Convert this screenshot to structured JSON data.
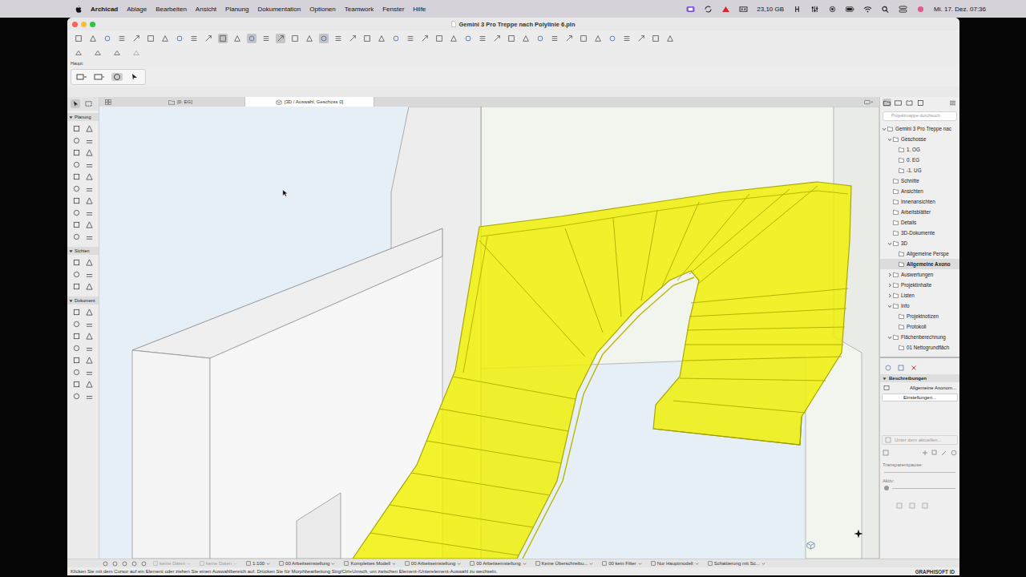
{
  "menubar": {
    "app": "Archicad",
    "items": [
      "Ablage",
      "Bearbeiten",
      "Ansicht",
      "Planung",
      "Dokumentation",
      "Optionen",
      "Teamwork",
      "Fenster",
      "Hilfe"
    ],
    "storage": "23,10 GB",
    "clock": "Mi. 17. Dez. 07:36"
  },
  "window": {
    "title": "Gemini 3 Pro Treppe nach Polylinie 6.pln"
  },
  "toolbar": [
    {
      "pressed": false
    },
    {
      "pressed": false
    },
    {
      "pressed": false
    },
    {
      "pressed": false
    },
    {
      "pressed": false
    },
    {
      "pressed": false
    },
    {
      "pressed": false
    },
    {
      "pressed": false
    },
    {
      "pressed": false
    },
    {
      "pressed": false
    },
    {
      "pressed": true
    },
    {
      "pressed": false
    },
    {
      "pressed": true
    },
    {
      "pressed": false
    },
    {
      "pressed": true
    },
    {
      "pressed": false
    },
    {
      "pressed": false
    },
    {
      "pressed": true
    },
    {
      "pressed": false
    },
    {
      "pressed": false
    },
    {
      "pressed": false
    },
    {
      "pressed": false
    },
    {
      "pressed": false
    },
    {
      "pressed": false
    },
    {
      "pressed": false
    },
    {
      "pressed": false
    },
    {
      "pressed": false
    },
    {
      "pressed": false
    },
    {
      "pressed": false
    },
    {
      "pressed": false
    },
    {
      "pressed": false
    },
    {
      "pressed": false
    },
    {
      "pressed": false
    },
    {
      "pressed": false
    },
    {
      "pressed": false
    },
    {
      "pressed": false
    },
    {
      "pressed": false
    },
    {
      "pressed": false
    },
    {
      "pressed": false
    },
    {
      "pressed": false
    },
    {
      "pressed": false
    },
    {
      "pressed": false
    }
  ],
  "infobox": {
    "label": "Haupt:"
  },
  "toolbox": {
    "pointer_selected": true,
    "sections": [
      {
        "label": "Planung",
        "expanded": true
      },
      {
        "label": "Sichten",
        "expanded": true
      },
      {
        "label": "Dokument",
        "expanded": true
      }
    ]
  },
  "tabs": [
    {
      "label": "[0. EG]",
      "selected": false
    },
    {
      "label": "[3D / Auswahl, Geschoss 0]",
      "selected": true
    }
  ],
  "navigator": {
    "search_placeholder": "Projektmappe durchsuch",
    "tree": [
      {
        "label": "Gemini 3 Pro Treppe nac",
        "kind": "open",
        "selected": false,
        "children": [
          {
            "label": "Geschosse",
            "kind": "open",
            "selected": false,
            "children": [
              {
                "label": "1. OG",
                "kind": "leaf",
                "selected": false
              },
              {
                "label": "0. EG",
                "kind": "leaf",
                "selected": false
              },
              {
                "label": "-1. UG",
                "kind": "leaf",
                "selected": false
              }
            ]
          },
          {
            "label": "Schnitte",
            "kind": "leaf",
            "selected": false
          },
          {
            "label": "Ansichten",
            "kind": "leaf",
            "selected": false
          },
          {
            "label": "Innenansichten",
            "kind": "leaf",
            "selected": false
          },
          {
            "label": "Arbeitsblätter",
            "kind": "leaf",
            "selected": false
          },
          {
            "label": "Details",
            "kind": "leaf",
            "selected": false
          },
          {
            "label": "3D-Dokumente",
            "kind": "leaf",
            "selected": false
          },
          {
            "label": "3D",
            "kind": "open",
            "selected": false,
            "children": [
              {
                "label": "Allgemeine Perspe",
                "kind": "leaf",
                "selected": false
              },
              {
                "label": "Allgemeine Axono",
                "kind": "leaf",
                "selected": true
              }
            ]
          },
          {
            "label": "Auswertungen",
            "kind": "closed",
            "selected": false
          },
          {
            "label": "Projektinhalte",
            "kind": "closed",
            "selected": false
          },
          {
            "label": "Listen",
            "kind": "closed",
            "selected": false
          },
          {
            "label": "Info",
            "kind": "open",
            "selected": false,
            "children": [
              {
                "label": "Projektnotizen",
                "kind": "leaf",
                "selected": false
              },
              {
                "label": "Protokoll",
                "kind": "leaf",
                "selected": false
              }
            ]
          },
          {
            "label": "Flächenberechnung",
            "kind": "open",
            "selected": false,
            "children": [
              {
                "label": "01 Nettogrundfläch",
                "kind": "leaf",
                "selected": false
              }
            ]
          }
        ]
      }
    ]
  },
  "properties": {
    "header": "Beschreibungen",
    "view_name": "Allgemeine Axonom...",
    "settings_button": "Einstellungen...",
    "layer_dropdown": "Unter dem aktuellen...",
    "transparency_label": "Transparentpause:",
    "active_label": "Aktiv:"
  },
  "status_bar": [
    {
      "label": "keine Daten",
      "disabled": true
    },
    {
      "label": "keine Daten",
      "disabled": true
    },
    {
      "label": "1:100",
      "disabled": false
    },
    {
      "label": "00 Arbeitseinstellung",
      "disabled": false
    },
    {
      "label": "Komplettes Modell",
      "disabled": false
    },
    {
      "label": "00 Arbeitseinstellung",
      "disabled": false
    },
    {
      "label": "00 Arbeitseinstellung",
      "disabled": false
    },
    {
      "label": "Keine Überschreibu...",
      "disabled": false
    },
    {
      "label": "00 kein Filter",
      "disabled": false
    },
    {
      "label": "Nur Hauptmodell",
      "disabled": false
    },
    {
      "label": "Schattierung mit Sc...",
      "disabled": false
    }
  ],
  "hint": "Klicken Sie mit dem Cursor auf ein Element oder ziehen Sie einen Auswahlbereich auf. Drücken Sie für Morphbearbeitung Strg/Ctrl+Umsch, um zwischen Element-/Unterelement-Auswahl zu wechseln.",
  "brand": "GRAPHISOFT ID"
}
